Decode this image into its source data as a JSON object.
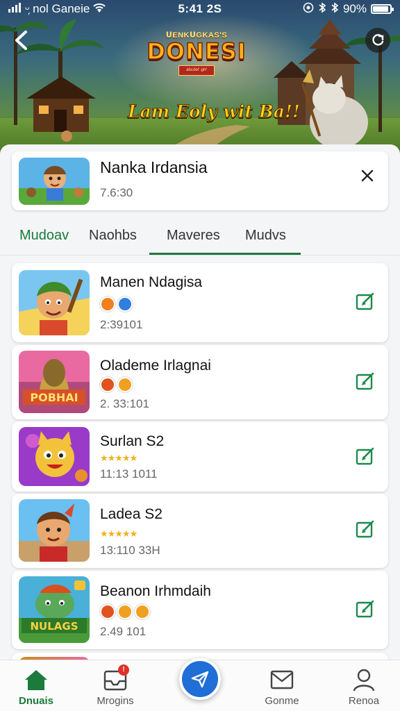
{
  "status_bar": {
    "carrier": "ᵕ᷊ nol Ganeie",
    "time": "5:41 2S",
    "battery": "90%",
    "battery_level": 0.9
  },
  "hero": {
    "logo_top": "ᑌENKᑌGKAS'S",
    "logo_main": "DONESI",
    "logo_ribbon": "ᵃᵇᶜᵈᵉᶠ ᵍʰⁱ",
    "tagline": "Lam Eoly wit Ba!!"
  },
  "featured": {
    "title": "Nanka Irdansia",
    "meta": "7.6:30"
  },
  "tabs": [
    {
      "label": "Mudoav"
    },
    {
      "label": "Naohbs"
    },
    {
      "label": "Maveres"
    },
    {
      "label": "Mudvs"
    }
  ],
  "items": [
    {
      "title": "Manen Ndagisa",
      "sub": "2:39101",
      "badges": [
        "#f0801e",
        "#2f7ee0"
      ],
      "stars": "",
      "rating": null
    },
    {
      "title": "Olademe Irlagnai",
      "sub": "2. 33:101",
      "badges": [
        "#e0531e",
        "#f0a020"
      ],
      "stars": "",
      "rating": null,
      "thumb_text": "POBHAI"
    },
    {
      "title": "Surlan S2",
      "sub": "11:13 1011",
      "badges": [],
      "stars": "★★★★★",
      "rating": 4.5
    },
    {
      "title": "Ladea S2",
      "sub": "13:110 33H",
      "badges": [],
      "stars": "★★★★★",
      "rating": 5
    },
    {
      "title": "Beanon Irhmdaih",
      "sub": "2.49 101",
      "badges": [
        "#e0531e",
        "#f0a020",
        "#f0a020"
      ],
      "stars": "",
      "rating": null,
      "thumb_text": "NULAGS"
    }
  ],
  "bottom_nav": [
    {
      "label": "Dnuais",
      "icon": "home-icon"
    },
    {
      "label": "Mrogins",
      "icon": "inbox-icon",
      "badge": "!"
    },
    {
      "label": "",
      "icon": "send-icon"
    },
    {
      "label": "Gonme",
      "icon": "mail-icon"
    },
    {
      "label": "Renoa",
      "icon": "profile-icon"
    }
  ],
  "colors": {
    "accent_green": "#1b7a3c",
    "fab_blue": "#1f6fd6",
    "star_gold": "#f2b01e"
  }
}
